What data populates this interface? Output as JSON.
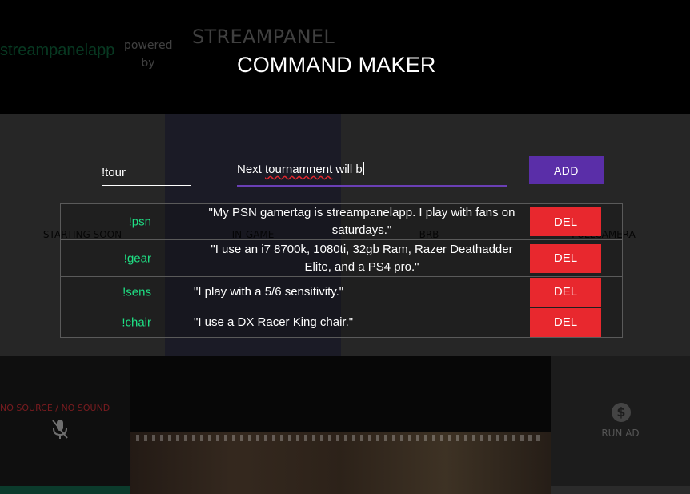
{
  "background": {
    "brand": "streampanelapp",
    "powered_by": "powered by",
    "app_name": "STREAMPANEL",
    "scenes": [
      "STARTING SOON",
      "IN-GAME",
      "BRB",
      "FULLCAMERA"
    ],
    "left_alert": "NO SOURCE / NO SOUND",
    "run_ad_label": "RUN AD"
  },
  "modal": {
    "title": "COMMAND MAKER",
    "command_input_value": "!tour",
    "response_prefix": "Next ",
    "response_misspelled": "tournamnent",
    "response_suffix": " will b",
    "add_label": "ADD",
    "delete_label": "DEL",
    "commands": [
      {
        "name": "!psn",
        "text": "\"My PSN gamertag is streampanelapp. I play with fans on saturdays.\""
      },
      {
        "name": "!gear",
        "text": "\"I use an i7 8700k, 1080ti, 32gb Ram, Razer Deathadder Elite, and a PS4 pro.\""
      },
      {
        "name": "!sens",
        "text": "\"I play with a 5/6 sensitivity.\""
      },
      {
        "name": "!chair",
        "text": "\"I use a DX Racer King chair.\""
      }
    ]
  },
  "colors": {
    "accent_green": "#1fe084",
    "add_purple": "#5a2ea8",
    "delete_red": "#e8282e"
  }
}
